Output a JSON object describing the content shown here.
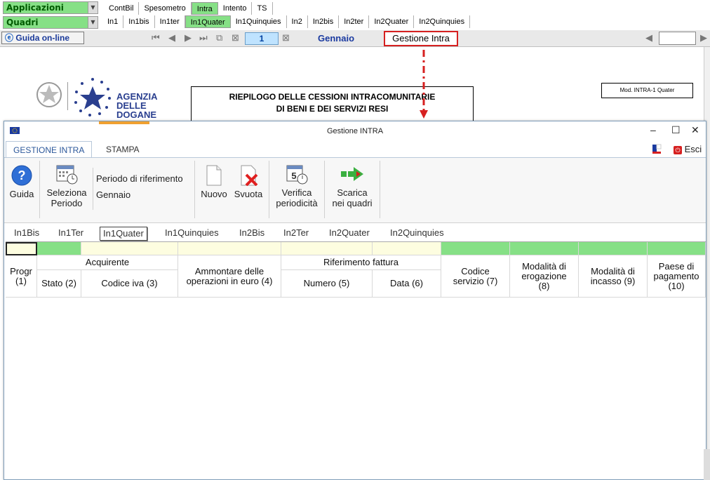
{
  "topbar": {
    "applicazioni": "Applicazioni",
    "quadri": "Quadri",
    "app_tabs": [
      "ContBil",
      "Spesometro",
      "Intra",
      "Intento",
      "TS"
    ],
    "quadri_tabs": [
      "In1",
      "In1bis",
      "In1ter",
      "In1Quater",
      "In1Quinquies",
      "In2",
      "In2bis",
      "In2ter",
      "In2Quater",
      "In2Quinquies"
    ],
    "active_app_tab": "Intra",
    "active_quadro_tab": "In1Quater"
  },
  "toolbar": {
    "guida_label": "Guida on-line",
    "page_number": "1",
    "month": "Gennaio",
    "gestione_button": "Gestione Intra"
  },
  "document": {
    "agency_line1": "AGENZIA",
    "agency_line2": "DELLE",
    "agency_line3": "DOGANE",
    "title_line1": "RIEPILOGO DELLE CESSIONI INTRACOMUNITARIE",
    "title_line2": "DI BENI E DEI SERVIZI RESI",
    "model": "Mod. INTRA-1 Quater"
  },
  "dialog": {
    "title": "Gestione INTRA",
    "tabs": [
      "GESTIONE INTRA",
      "STAMPA"
    ],
    "esci": "Esci",
    "ribbon": {
      "guida": "Guida",
      "seleziona_line1": "Seleziona",
      "seleziona_line2": "Periodo",
      "periodo_label": "Periodo di riferimento",
      "periodo_value": "Gennaio",
      "nuovo": "Nuovo",
      "svuota": "Svuota",
      "verifica_line1": "Verifica",
      "verifica_line2": "periodicità",
      "scarica_line1": "Scarica",
      "scarica_line2": "nei quadri"
    },
    "subtabs": [
      "In1Bis",
      "In1Ter",
      "In1Quater",
      "In1Quinquies",
      "In2Bis",
      "In2Ter",
      "In2Quater",
      "In2Quinquies"
    ],
    "active_subtab": "In1Quater",
    "grid": {
      "progr": "Progr (1)",
      "acquirente": "Acquirente",
      "stato": "Stato (2)",
      "codice_iva": "Codice iva (3)",
      "ammontare": "Ammontare delle operazioni in euro (4)",
      "riferimento": "Riferimento fattura",
      "numero": "Numero (5)",
      "data": "Data (6)",
      "codice_servizio": "Codice servizio (7)",
      "modalita_erogazione": "Modalità di erogazione (8)",
      "modalita_incasso": "Modalità di incasso (9)",
      "paese": "Paese di pagamento (10)"
    }
  },
  "colors": {
    "green": "#86e086",
    "cream": "#fdfde0",
    "accent_red": "#d62020",
    "ribbon_blue": "#2b579a"
  }
}
